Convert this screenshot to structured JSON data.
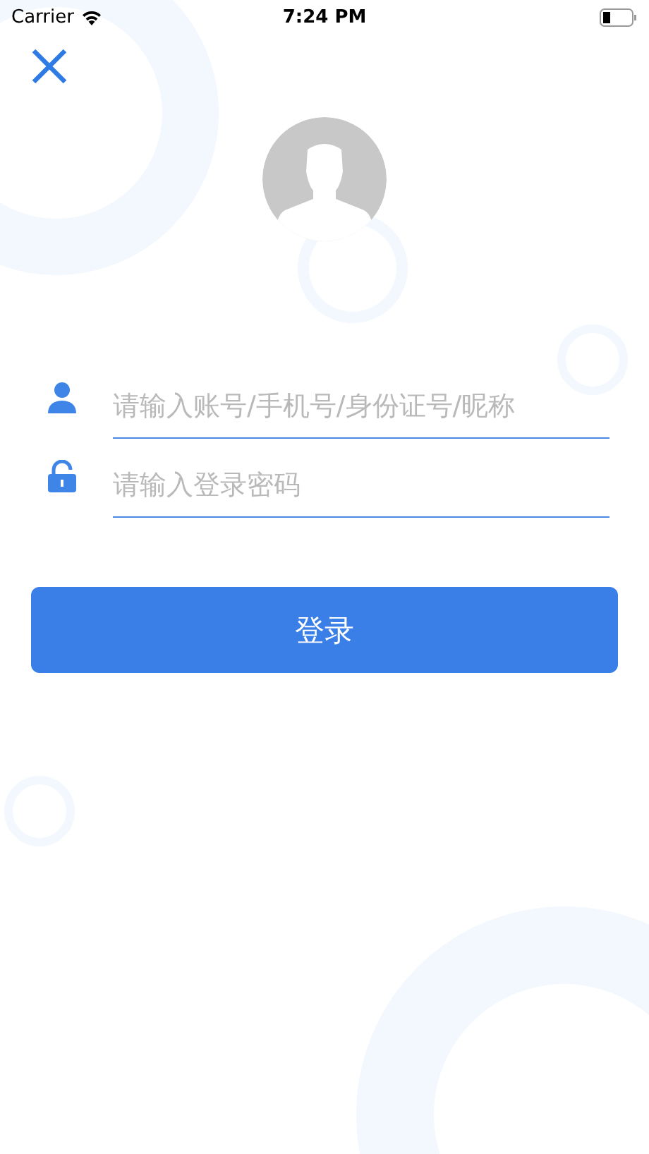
{
  "status_bar": {
    "carrier": "Carrier",
    "time": "7:24 PM"
  },
  "fields": [
    {
      "kind": "account",
      "placeholder": "请输入账号/手机号/身份证号/昵称"
    },
    {
      "kind": "password",
      "placeholder": "请输入登录密码"
    }
  ],
  "login_button": "登录"
}
